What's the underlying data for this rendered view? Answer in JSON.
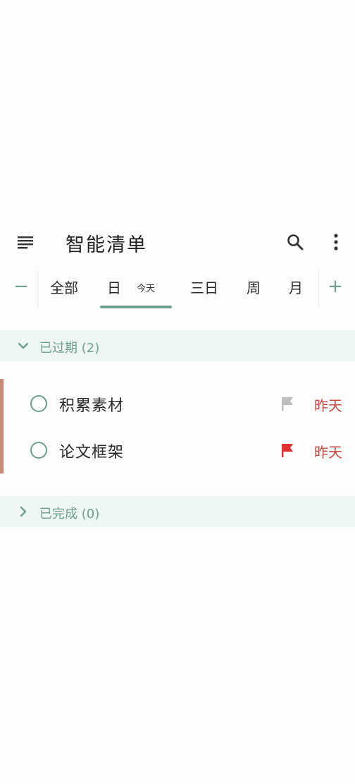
{
  "app": {
    "title": "智能清单"
  },
  "icons": {
    "menu": "menu-icon",
    "search": "search-icon",
    "more": "more-vert-icon"
  },
  "tabs": {
    "minus": "−",
    "plus": "+",
    "items": [
      {
        "label": "全部"
      },
      {
        "label": "日",
        "sub": "今天",
        "selected": true
      },
      {
        "label": "三日"
      },
      {
        "label": "周"
      },
      {
        "label": "月"
      }
    ]
  },
  "sections": {
    "overdue": {
      "label": "已过期 (2)",
      "expanded": true
    },
    "completed": {
      "label": "已完成 (0)",
      "expanded": false
    }
  },
  "tasks": [
    {
      "title": "积累素材",
      "flag_color": "#bdbdbd",
      "due": "昨天"
    },
    {
      "title": "论文框架",
      "flag_color": "#e0302d",
      "due": "昨天"
    }
  ],
  "colors": {
    "accent": "#6e9e92",
    "section_bg": "#eff7f4",
    "due": "#c64a3e",
    "group_bar": "#c88978"
  }
}
